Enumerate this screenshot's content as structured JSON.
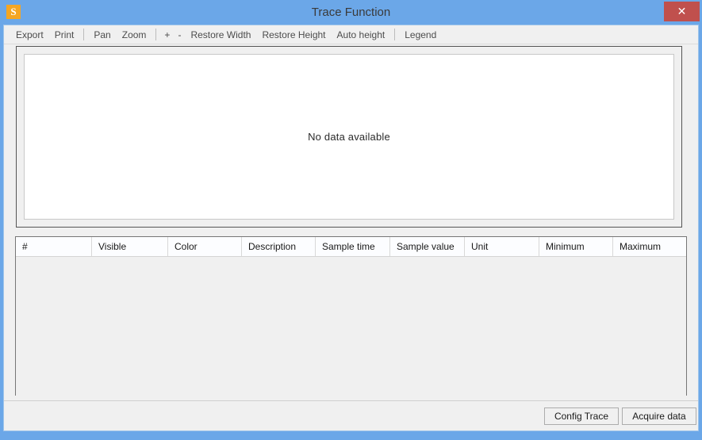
{
  "window": {
    "title": "Trace Function",
    "app_icon": "S",
    "app_icon_color": "#f5a623",
    "titlebar_color": "#6ba7e8",
    "close_label": "✕",
    "close_color": "#c0504d"
  },
  "toolbar": {
    "items": [
      {
        "label": "Export",
        "name": "toolbar-export"
      },
      {
        "label": "Print",
        "name": "toolbar-print"
      },
      {
        "label": "Pan",
        "name": "toolbar-pan"
      },
      {
        "label": "Zoom",
        "name": "toolbar-zoom"
      },
      {
        "label": "+",
        "name": "toolbar-zoom-in"
      },
      {
        "label": "-",
        "name": "toolbar-zoom-out"
      },
      {
        "label": "Restore Width",
        "name": "toolbar-restore-width"
      },
      {
        "label": "Restore Height",
        "name": "toolbar-restore-height"
      },
      {
        "label": "Auto height",
        "name": "toolbar-auto-height"
      },
      {
        "label": "Legend",
        "name": "toolbar-legend"
      }
    ]
  },
  "chart": {
    "empty_message": "No data available"
  },
  "table": {
    "columns": [
      "#",
      "Visible",
      "Color",
      "Description",
      "Sample time",
      "Sample value",
      "Unit",
      "Minimum",
      "Maximum"
    ],
    "rows": []
  },
  "footer": {
    "config_trace_label": "Config Trace",
    "acquire_data_label": "Acquire data"
  }
}
